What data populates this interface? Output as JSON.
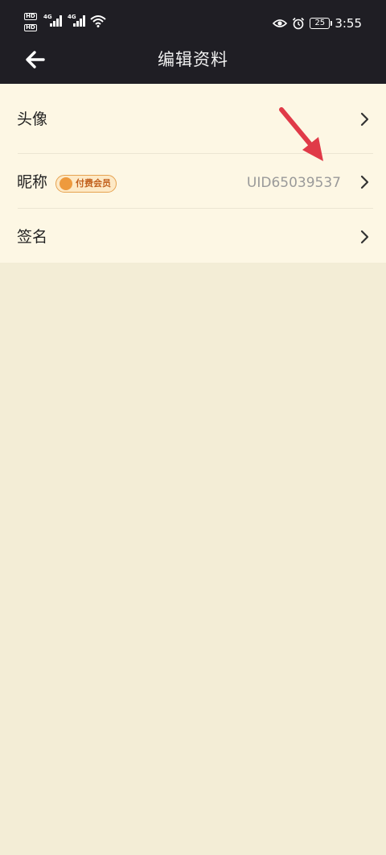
{
  "status_bar": {
    "network_type_1": "4G",
    "network_type_2": "4G",
    "hd_1": "HD",
    "hd_2": "HD",
    "battery_level": "25",
    "time": "3:55",
    "icons": [
      "signal-icon",
      "wifi-icon",
      "eye-icon",
      "alarm-icon",
      "battery-icon"
    ]
  },
  "header": {
    "title": "编辑资料",
    "back_icon": "back-arrow-icon"
  },
  "profile_rows": [
    {
      "label": "头像",
      "value": ""
    },
    {
      "label": "昵称",
      "badge": "付费会员",
      "value": "UID65039537"
    },
    {
      "label": "签名",
      "value": ""
    }
  ],
  "colors": {
    "header_bg": "#1f1e24",
    "list_bg": "#fdf7e4",
    "page_bg": "#f3edd6",
    "badge_text": "#c2601c",
    "annotation_arrow": "#e03a48"
  }
}
